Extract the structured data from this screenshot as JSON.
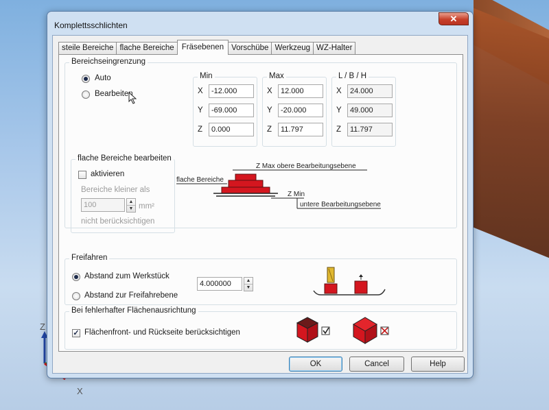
{
  "window": {
    "title": "Komplettsschlichten",
    "close_glyph": "✕"
  },
  "tabs": [
    {
      "label": "steile Bereiche",
      "active": false
    },
    {
      "label": "flache Bereiche",
      "active": false
    },
    {
      "label": "Fräsebenen",
      "active": true
    },
    {
      "label": "Vorschübe",
      "active": false
    },
    {
      "label": "Werkzeug",
      "active": false
    },
    {
      "label": "WZ-Halter",
      "active": false
    }
  ],
  "bereich": {
    "legend": "Bereichseingrenzung",
    "auto_label": "Auto",
    "bearbeiten_label": "Bearbeiten",
    "selected": "Auto",
    "min": {
      "title": "Min",
      "x": "-12.000",
      "y": "-69.000",
      "z": "0.000"
    },
    "max": {
      "title": "Max",
      "x": "12.000",
      "y": "-20.000",
      "z": "11.797"
    },
    "lbh": {
      "title": "L / B / H",
      "x": "24.000",
      "y": "49.000",
      "z": "11.797"
    },
    "axis_x": "X",
    "axis_y": "Y",
    "axis_z": "Z"
  },
  "flache": {
    "legend": "flache Bereiche bearbeiten",
    "aktivieren_label": "aktivieren",
    "aktivieren_checked": false,
    "kleiner_label": "Bereiche kleiner als",
    "value": "100",
    "unit": "mm²",
    "nicht_label": "nicht berücksichtigen",
    "diagram": {
      "zmax_label": "Z Max  obere Bearbeitungsebene",
      "flache_label": "flache Bereiche",
      "zmin_label": "Z Min",
      "untere_label": "untere Bearbeitungsebene"
    }
  },
  "freifahren": {
    "legend": "Freifahren",
    "abstand_werkstueck_label": "Abstand zum Werkstück",
    "abstand_freifahrebene_label": "Abstand zur Freifahrebene",
    "selected": "Abstand zum Werkstück",
    "value": "4.000000"
  },
  "fehler": {
    "legend": "Bei fehlerhafter Flächenausrichtung",
    "checkbox_label": "Flächenfront- und Rückseite berücksichtigen",
    "checked": true
  },
  "buttons": {
    "ok": "OK",
    "cancel": "Cancel",
    "help": "Help"
  },
  "colors": {
    "accent_red": "#d4161f",
    "dark_red": "#6b1a1a",
    "titlebar_blue": "#cfe0f2"
  },
  "axes": {
    "z_label": "Z",
    "x_label": "X"
  }
}
